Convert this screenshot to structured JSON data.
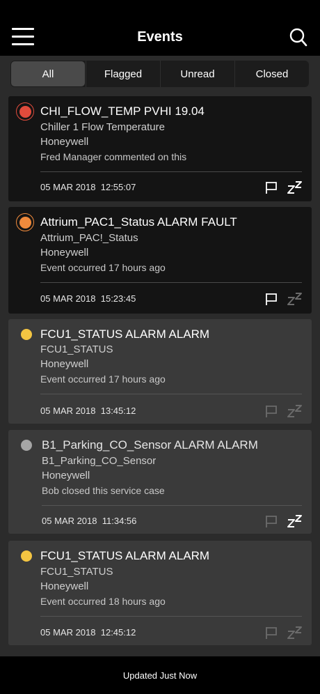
{
  "header": {
    "title": "Events"
  },
  "tabs": [
    {
      "label": "All"
    },
    {
      "label": "Flagged"
    },
    {
      "label": "Unread"
    },
    {
      "label": "Closed"
    }
  ],
  "colors": {
    "red": "#e04b3c",
    "orange": "#f08a3c",
    "yellow": "#f4c542",
    "gray": "#a6a6a6",
    "icon_active": "#ffffff",
    "icon_dim": "#6b6b6b"
  },
  "events": [
    {
      "name": "CHI_FLOW_TEMP PVHI 19.04",
      "point": "Chiller 1 Flow Temperature",
      "source": "Honeywell",
      "note": "Fred Manager commented on this",
      "date": "05 MAR 2018",
      "time": "12:55:07",
      "severity": "red",
      "flag_icon": "flag-icon",
      "snooze_icon": "snooze-icon"
    },
    {
      "name": "Attrium_PAC1_Status ALARM FAULT",
      "point": "Attrium_PAC!_Status",
      "source": "Honeywell",
      "note": "Event occurred 17 hours ago",
      "date": "05 MAR 2018",
      "time": "15:23:45",
      "severity": "orange",
      "flag_icon": "flag-icon",
      "snooze_icon": "snooze-icon"
    },
    {
      "name": "FCU1_STATUS ALARM ALARM",
      "point": "FCU1_STATUS",
      "source": "Honeywell",
      "note": "Event occurred 17 hours ago",
      "date": "05 MAR 2018",
      "time": "13:45:12",
      "severity": "yellow",
      "flag_icon": "flag-icon",
      "snooze_icon": "snooze-icon"
    },
    {
      "name": "B1_Parking_CO_Sensor ALARM ALARM",
      "point": "B1_Parking_CO_Sensor",
      "source": "Honeywell",
      "note": "Bob closed this service case",
      "date": "05 MAR 2018",
      "time": "11:34:56",
      "severity": "gray",
      "flag_icon": "flag-icon",
      "snooze_icon": "snooze-icon"
    },
    {
      "name": "FCU1_STATUS ALARM ALARM",
      "point": "FCU1_STATUS",
      "source": "Honeywell",
      "note": "Event occurred 18 hours ago",
      "date": "05 MAR 2018",
      "time": "12:45:12",
      "severity": "yellow",
      "flag_icon": "flag-icon",
      "snooze_icon": "snooze-icon"
    }
  ],
  "footer": {
    "status": "Updated Just Now"
  }
}
